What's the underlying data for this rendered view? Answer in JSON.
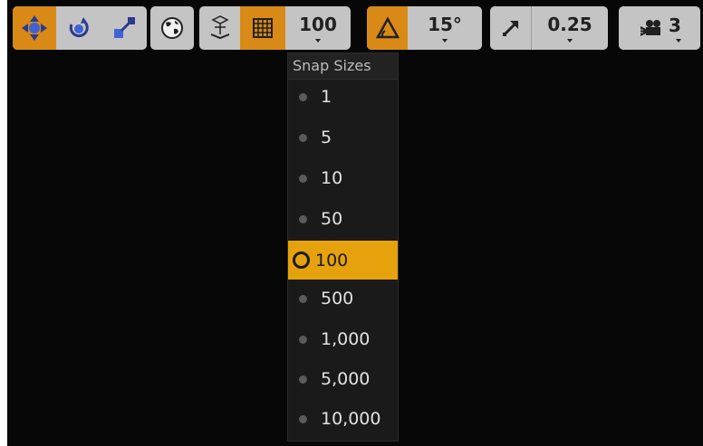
{
  "toolbar": {
    "transform_group": {
      "translate_icon": "translate-arrows-icon",
      "rotate_icon": "rotate-icon",
      "scale_icon": "scale-icon",
      "active": "translate"
    },
    "coordinate_space_icon": "globe-icon",
    "surface_snap_icon": "surface-snap-icon",
    "grid_snap": {
      "icon": "grid-icon",
      "active": true,
      "value": "100"
    },
    "rotation_snap": {
      "icon": "angle-icon",
      "active": true,
      "value": "15°"
    },
    "scale_snap": {
      "icon": "scale-arrow-icon",
      "value": "0.25"
    },
    "camera_speed": {
      "icon": "camera-icon",
      "value": "3"
    }
  },
  "dropdown": {
    "title": "Snap Sizes",
    "items": [
      "1",
      "5",
      "10",
      "50",
      "100",
      "500",
      "1,000",
      "5,000",
      "10,000"
    ],
    "selected": "100"
  },
  "colors": {
    "accent": "#d98a16",
    "selected_item": "#e5a20c",
    "viewport_bg": "#070707",
    "button_bg": "#c4c4c4"
  }
}
